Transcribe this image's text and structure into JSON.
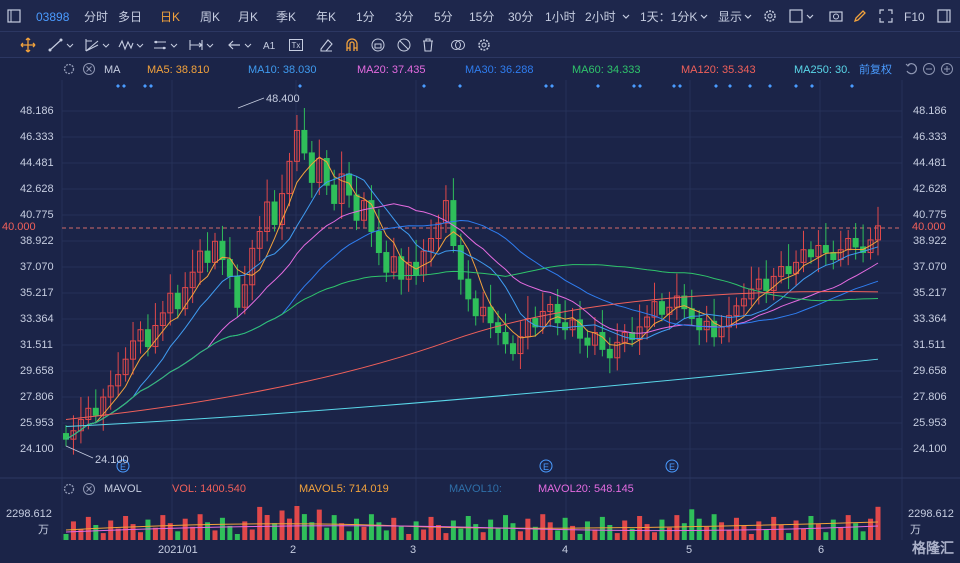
{
  "topbar": {
    "code": "03898",
    "periods": [
      "分时",
      "多日",
      "日K",
      "周K",
      "月K",
      "季K",
      "年K",
      "1分",
      "3分",
      "5分",
      "15分",
      "30分",
      "1小时",
      "2小时",
      "1天：1分K"
    ],
    "active_period": "日K",
    "display_label": "显示",
    "f10_label": "F10"
  },
  "ma_legend": {
    "label": "MA",
    "items": [
      {
        "text": "MA5: 38.810",
        "color": "#f2a23c"
      },
      {
        "text": "MA10: 38.030",
        "color": "#3f9bf0"
      },
      {
        "text": "MA20: 37.435",
        "color": "#e46be0"
      },
      {
        "text": "MA30: 36.288",
        "color": "#2f7df0"
      },
      {
        "text": "MA60: 34.333",
        "color": "#2fc46b"
      },
      {
        "text": "MA120: 35.343",
        "color": "#f0605a"
      },
      {
        "text": "MA250: 30.",
        "color": "#5ad8ea"
      }
    ],
    "adjust_label": "前复权"
  },
  "vol_legend": {
    "label": "MAVOL",
    "items": [
      {
        "text": "VOL: 1400.540",
        "color": "#f0605a"
      },
      {
        "text": "MAVOL5: 714.019",
        "color": "#f2a23c"
      },
      {
        "text": "MAVOL10:",
        "color": "#2f6fa8"
      },
      {
        "text": "MAVOL20: 548.145",
        "color": "#e46be0"
      }
    ]
  },
  "chart_data": {
    "type": "candlestick",
    "y_ticks": [
      "48.186",
      "46.333",
      "44.481",
      "42.628",
      "40.775",
      "38.922",
      "37.070",
      "35.217",
      "33.364",
      "31.511",
      "29.658",
      "27.806",
      "25.953",
      "24.100"
    ],
    "y_range": [
      24.1,
      48.186
    ],
    "current_price": "40.000",
    "high_label": "48.400",
    "low_label": "24.100",
    "x_labels": [
      "2021/01",
      "2",
      "3",
      "4",
      "5",
      "6"
    ],
    "vol_tick": "2298.612",
    "vol_unit": "万",
    "event_marker": "E",
    "moving_averages": [
      "MA5",
      "MA10",
      "MA20",
      "MA30",
      "MA60",
      "MA120",
      "MA250"
    ]
  },
  "logo": {
    "text": "格隆汇"
  }
}
